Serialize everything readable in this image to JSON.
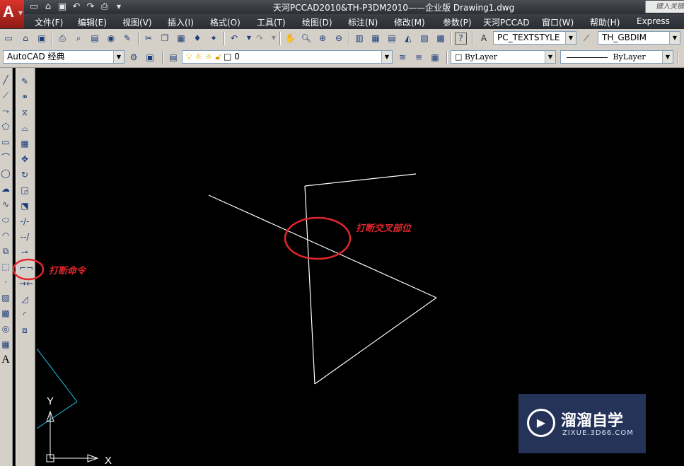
{
  "title_bar": {
    "logo_letter": "A",
    "window_title": "天河PCCAD2010&TH-P3DM2010——企业版    Drawing1.dwg",
    "search_placeholder": "键入关键"
  },
  "menu": {
    "items": [
      "文件(F)",
      "编辑(E)",
      "视图(V)",
      "插入(I)",
      "格式(O)",
      "工具(T)",
      "绘图(D)",
      "标注(N)",
      "修改(M)",
      "参数(P)",
      "天河PCCAD",
      "窗口(W)",
      "帮助(H)",
      "Express"
    ]
  },
  "toolbar1": {
    "text_style": "PC_TEXTSTYLE",
    "dim_style": "TH_GBDIM"
  },
  "toolbar2": {
    "workspace": "AutoCAD 经典",
    "layer": "0",
    "color": "ByLayer",
    "linetype": "ByLayer"
  },
  "drawing": {
    "annotation_break_point": "打断交叉部位",
    "annotation_break_command": "打断命令",
    "ucs_x_label": "X",
    "ucs_y_label": "Y",
    "line_color": "#ffffff",
    "annotation_color": "#e3262c",
    "aux_line_color": "#1ec8e8"
  },
  "watermark": {
    "title": "溜溜自学",
    "url": "ZIXUE.3D66.COM"
  }
}
